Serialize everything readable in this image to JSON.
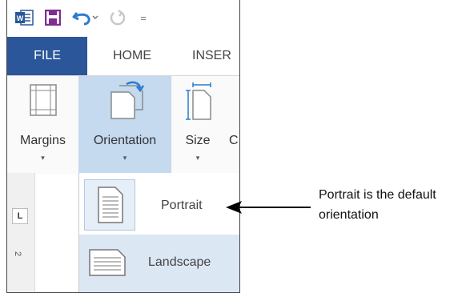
{
  "qat": {
    "word_icon_text": "W",
    "customize_glyph": "="
  },
  "tabs": [
    "FILE",
    "HOME",
    "INSER"
  ],
  "ribbon": {
    "buttons": [
      {
        "label": "Margins",
        "icon": "margins-icon"
      },
      {
        "label": "Orientation",
        "icon": "orientation-icon"
      },
      {
        "label": "Size",
        "icon": "size-icon"
      },
      {
        "label": "C",
        "icon": "columns-icon"
      }
    ],
    "caret": "▾"
  },
  "ruler": {
    "corner_glyph": "L",
    "number": "2"
  },
  "dropdown": {
    "items": [
      {
        "label": "Portrait",
        "icon": "portrait-page-icon"
      },
      {
        "label": "Landscape",
        "icon": "landscape-page-icon"
      }
    ]
  },
  "callout": {
    "line1": "Portrait is the default",
    "line2": "orientation"
  },
  "colors": {
    "file_tab": "#2b579a",
    "active_button": "#c5d9ef",
    "word_blue": "#2b579a",
    "save_purple": "#7d2e8f",
    "undo_blue": "#2b7cd3"
  }
}
